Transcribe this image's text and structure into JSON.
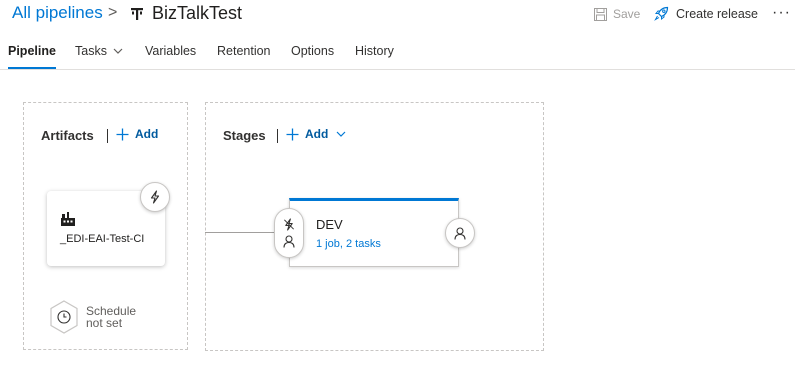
{
  "header": {
    "breadcrumb_root": "All pipelines",
    "breadcrumb_separator": ">",
    "pipeline_name": "BizTalkTest",
    "save_label": "Save",
    "create_release_label": "Create release",
    "more_label": "···",
    "accent_color": "#0078d4"
  },
  "tabs": [
    {
      "label": "Pipeline",
      "active": true
    },
    {
      "label": "Tasks",
      "has_dropdown": true
    },
    {
      "label": "Variables"
    },
    {
      "label": "Retention"
    },
    {
      "label": "Options"
    },
    {
      "label": "History"
    }
  ],
  "artifacts": {
    "title": "Artifacts",
    "add_label": "Add",
    "items": [
      {
        "name": "_EDI-EAI-Test-CI",
        "icon": "build-artifact-icon"
      }
    ],
    "schedule_line1": "Schedule",
    "schedule_line2": "not set"
  },
  "stages": {
    "title": "Stages",
    "add_label": "Add",
    "items": [
      {
        "name": "DEV",
        "detail": "1 job, 2 tasks"
      }
    ]
  }
}
